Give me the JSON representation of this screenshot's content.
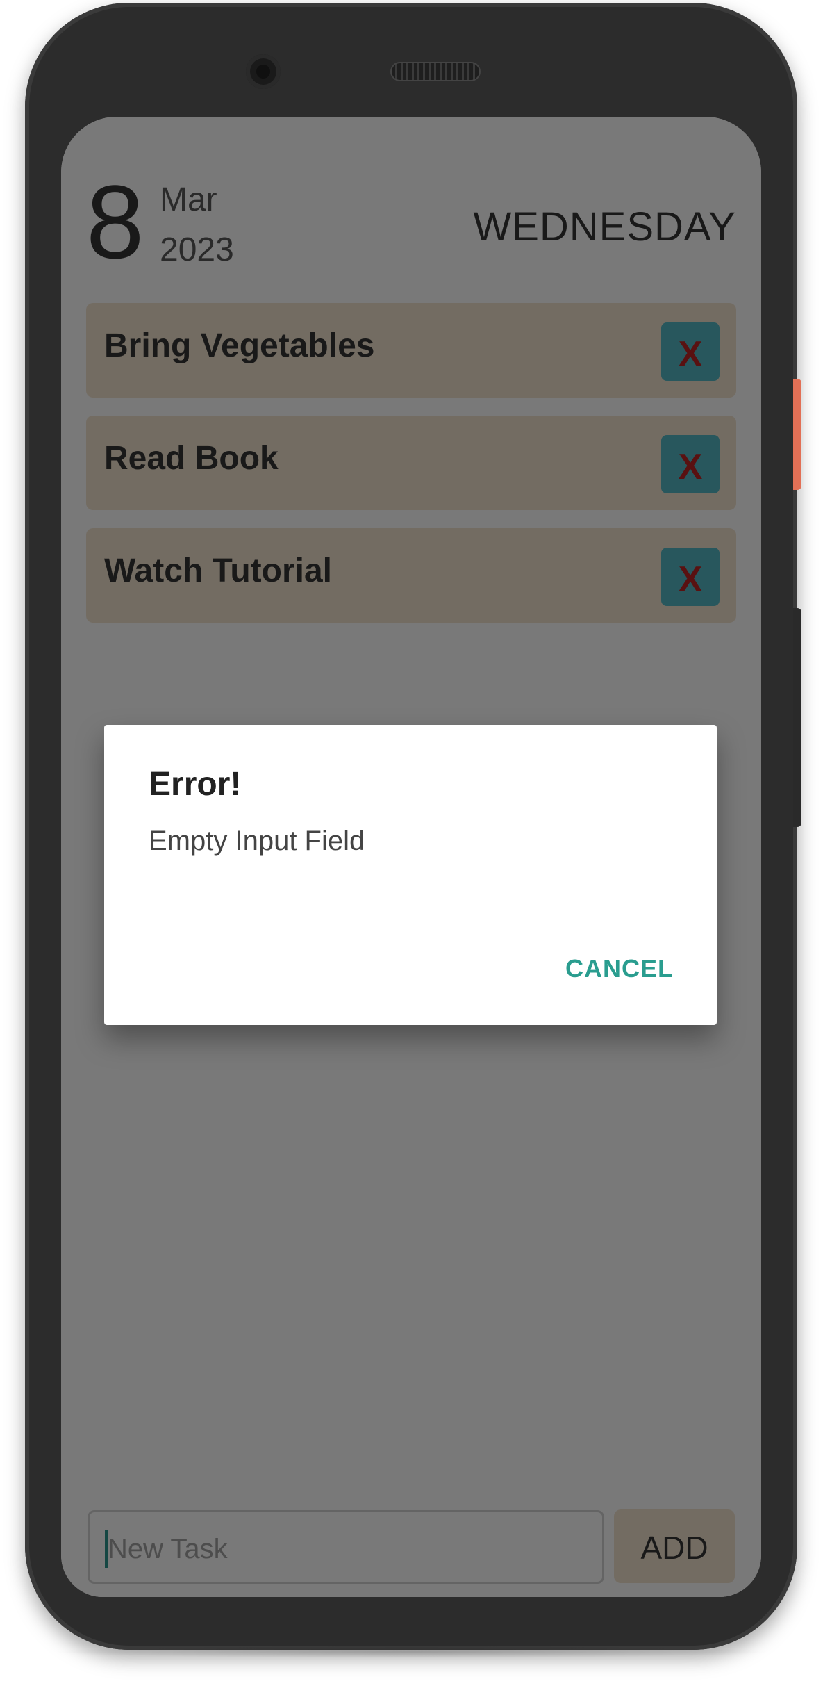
{
  "header": {
    "day": "8",
    "month": "Mar",
    "year": "2023",
    "weekday": "WEDNESDAY"
  },
  "tasks": [
    {
      "label": "Bring Vegetables",
      "delete_label": "X"
    },
    {
      "label": "Read Book",
      "delete_label": "X"
    },
    {
      "label": "Watch Tutorial",
      "delete_label": "X"
    }
  ],
  "input": {
    "placeholder": "New Task",
    "value": ""
  },
  "add_button": {
    "label": "ADD"
  },
  "dialog": {
    "title": "Error!",
    "message": "Empty Input Field",
    "cancel_label": "CANCEL"
  },
  "colors": {
    "task_background": "#e6d8c4",
    "delete_button": "#51aeba",
    "delete_text": "#b22222",
    "accent": "#2a9d8f",
    "device_orange_button": "#e27056"
  }
}
